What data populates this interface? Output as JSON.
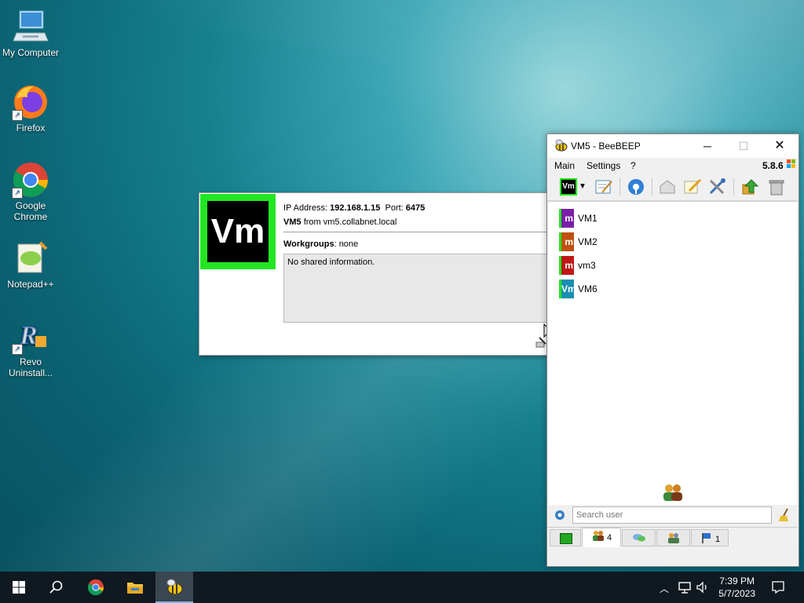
{
  "desktop": {
    "icons": [
      {
        "label": "My Computer"
      },
      {
        "label": "Firefox"
      },
      {
        "label": "Google Chrome"
      },
      {
        "label": "Notepad++"
      },
      {
        "label": "Revo Uninstall..."
      }
    ]
  },
  "popup": {
    "avatar_text": "Vm",
    "ip_label": "IP Address:",
    "ip_value": "192.168.1.15",
    "port_label": "Port:",
    "port_value": "6475",
    "user_name": "VM5",
    "from_text": "from vm5.collabnet.local",
    "workgroups_label": "Workgroups",
    "workgroups_value": ": none",
    "shared_info": "No shared information."
  },
  "window": {
    "title": "VM5 - BeeBEEP",
    "version": "5.8.6",
    "menu": [
      "Main",
      "Settings",
      "?"
    ],
    "my_avatar": "Vm",
    "users": [
      {
        "name": "VM1",
        "avatar": "m",
        "color": "#7a1fa8"
      },
      {
        "name": "VM2",
        "avatar": "m",
        "color": "#c05010"
      },
      {
        "name": "vm3",
        "avatar": "m",
        "color": "#c01818"
      },
      {
        "name": "VM6",
        "avatar": "Vm",
        "color": "#1a8fb0"
      }
    ],
    "search_placeholder": "Search user",
    "tabs": [
      {
        "label": ""
      },
      {
        "label": "4"
      },
      {
        "label": ""
      },
      {
        "label": ""
      },
      {
        "label": "1"
      }
    ]
  },
  "taskbar": {
    "time": "7:39 PM",
    "date": "5/7/2023"
  },
  "colors": {
    "accent_green": "#22e622",
    "titlebar": "#ffffff",
    "taskbar": "#101820"
  }
}
